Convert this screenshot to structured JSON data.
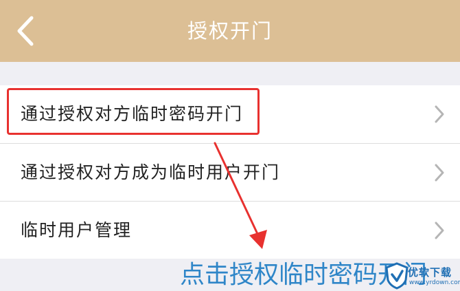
{
  "header": {
    "title": "授权开门",
    "back_icon": "chevron-left-icon"
  },
  "menu": {
    "items": [
      {
        "label": "通过授权对方临时密码开门",
        "icon": "chevron-right-icon"
      },
      {
        "label": "通过授权对方成为临时用户开门",
        "icon": "chevron-right-icon"
      },
      {
        "label": "临时用户管理",
        "icon": "chevron-right-icon"
      }
    ]
  },
  "annotation": {
    "caption": "点击授权临时密码开门",
    "highlight_color": "#e8312f",
    "caption_color": "#2f86c8"
  },
  "watermark": {
    "brand": "优软下载",
    "url": "www.yrdown.com"
  },
  "colors": {
    "header": "#dcbf95",
    "background": "#efeff4"
  }
}
